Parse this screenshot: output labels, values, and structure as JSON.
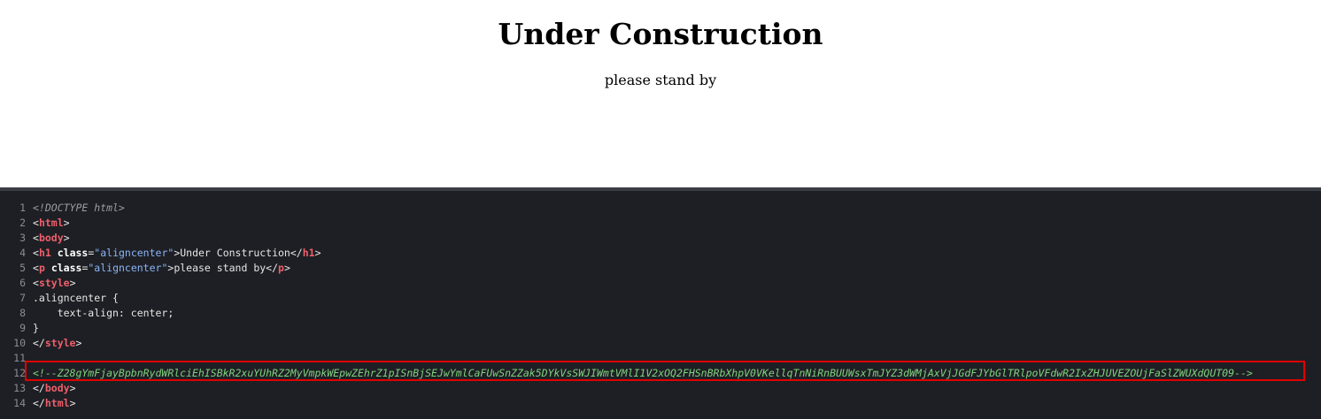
{
  "rendered": {
    "heading": "Under Construction",
    "paragraph": "please stand by"
  },
  "source": {
    "lines": [
      {
        "n": "1",
        "parts": [
          {
            "t": "<!DOCTYPE html>",
            "c": "doctype"
          }
        ]
      },
      {
        "n": "2",
        "parts": [
          {
            "t": "<",
            "c": "punct"
          },
          {
            "t": "html",
            "c": "tag"
          },
          {
            "t": ">",
            "c": "punct"
          }
        ]
      },
      {
        "n": "3",
        "parts": [
          {
            "t": "<",
            "c": "punct"
          },
          {
            "t": "body",
            "c": "tag"
          },
          {
            "t": ">",
            "c": "punct"
          }
        ]
      },
      {
        "n": "4",
        "parts": [
          {
            "t": "<",
            "c": "punct"
          },
          {
            "t": "h1",
            "c": "tag"
          },
          {
            "t": " ",
            "c": "plain"
          },
          {
            "t": "class",
            "c": "attr"
          },
          {
            "t": "=",
            "c": "punct"
          },
          {
            "t": "\"aligncenter\"",
            "c": "str"
          },
          {
            "t": ">Under Construction</",
            "c": "plain"
          },
          {
            "t": "h1",
            "c": "tag"
          },
          {
            "t": ">",
            "c": "punct"
          }
        ]
      },
      {
        "n": "5",
        "parts": [
          {
            "t": "<",
            "c": "punct"
          },
          {
            "t": "p",
            "c": "tag"
          },
          {
            "t": " ",
            "c": "plain"
          },
          {
            "t": "class",
            "c": "attr"
          },
          {
            "t": "=",
            "c": "punct"
          },
          {
            "t": "\"aligncenter\"",
            "c": "str"
          },
          {
            "t": ">please stand by</",
            "c": "plain"
          },
          {
            "t": "p",
            "c": "tag"
          },
          {
            "t": ">",
            "c": "punct"
          }
        ]
      },
      {
        "n": "6",
        "parts": [
          {
            "t": "<",
            "c": "punct"
          },
          {
            "t": "style",
            "c": "tag"
          },
          {
            "t": ">",
            "c": "punct"
          }
        ]
      },
      {
        "n": "7",
        "parts": [
          {
            "t": ".aligncenter {",
            "c": "plain"
          }
        ]
      },
      {
        "n": "8",
        "parts": [
          {
            "t": "    text-align: center;",
            "c": "plain"
          }
        ]
      },
      {
        "n": "9",
        "parts": [
          {
            "t": "}",
            "c": "plain"
          }
        ]
      },
      {
        "n": "10",
        "parts": [
          {
            "t": "</",
            "c": "punct"
          },
          {
            "t": "style",
            "c": "tag"
          },
          {
            "t": ">",
            "c": "punct"
          }
        ]
      },
      {
        "n": "11",
        "parts": []
      },
      {
        "n": "12",
        "parts": [
          {
            "t": "<!--Z28gYmFjayBpbnRydWRlciEhISBkR2xuYUhRZ2MyVmpkWEpwZEhrZ1pISnBjSEJwYmlCaFUwSnZZak5DYkVsSWJIWmtVMlI1V2xOQ2FHSnBRbXhpV0VKellqTnNiRnBUUWsxTmJYZ3dWMjAxVjJGdFJYbGlTRlpoVFdwR2IxZHJUVEZOUjFaSlZWUXdQUT09-->",
            "c": "comment"
          }
        ]
      },
      {
        "n": "13",
        "parts": [
          {
            "t": "</",
            "c": "punct"
          },
          {
            "t": "body",
            "c": "tag"
          },
          {
            "t": ">",
            "c": "punct"
          }
        ]
      },
      {
        "n": "14",
        "parts": [
          {
            "t": "</",
            "c": "punct"
          },
          {
            "t": "html",
            "c": "tag"
          },
          {
            "t": ">",
            "c": "punct"
          }
        ]
      }
    ],
    "highlighted_line": "12"
  },
  "colors": {
    "code_background": "#1e1f24",
    "tag": "#ef5f6b",
    "string": "#8ab4f8",
    "comment": "#7fd17f",
    "highlight_border": "#e00000"
  }
}
